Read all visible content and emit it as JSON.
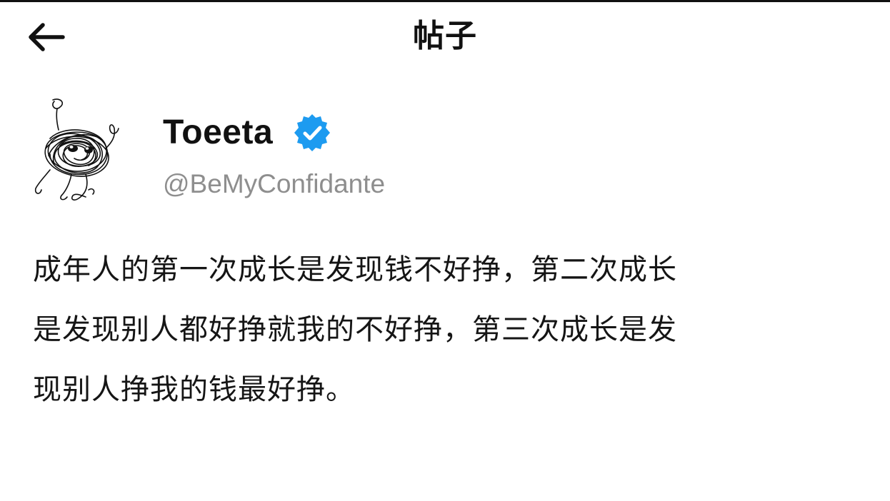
{
  "header": {
    "title": "帖子",
    "back_icon": "arrow-left-icon"
  },
  "author": {
    "display_name": "Toeeta",
    "verified_icon": "verified-badge-icon",
    "verified_color": "#1d9bf0",
    "handle": "@BeMyConfidante",
    "avatar": "scribble-figure-avatar"
  },
  "post": {
    "lines": [
      "成年人的第一次成长是发现钱不好挣，第二次成长",
      "是发现别人都好挣就我的不好挣，第三次成长是发",
      "现别人挣我的钱最好挣。"
    ]
  },
  "colors": {
    "background": "#ffffff",
    "text": "#111111",
    "handle": "#8e8e8e"
  }
}
